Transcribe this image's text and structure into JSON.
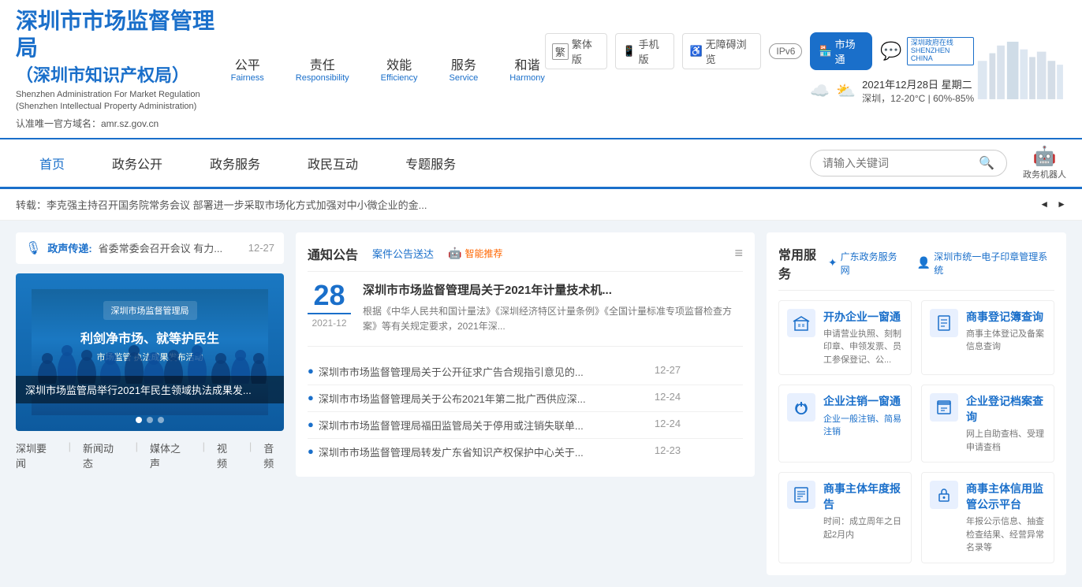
{
  "header": {
    "logo_title": "深圳市市场监督管理局",
    "logo_subtitle_line1": "（深圳市知识产权局）",
    "logo_en_line1": "Shenzhen Administration For Market Regulation",
    "logo_en_line2": "(Shenzhen Intellectual Property Administration)",
    "domain_label": "认准唯一官方域名：amr.sz.gov.cn",
    "tools": {
      "traditional": "繁体版",
      "mobile": "手机版",
      "accessible": "无障碍浏览",
      "ipv6": "IPv6",
      "market": "市场通"
    },
    "values": [
      {
        "cn": "公平",
        "en": "Fairness"
      },
      {
        "cn": "责任",
        "en": "Responsibility"
      },
      {
        "cn": "效能",
        "en": "Efficiency"
      },
      {
        "cn": "服务",
        "en": "Service"
      },
      {
        "cn": "和谐",
        "en": "Harmony"
      }
    ],
    "weather": {
      "date": "2021年12月28日 星期二",
      "location": "深圳，12-20°C",
      "humidity": "60%-85%"
    }
  },
  "nav": {
    "items": [
      "首页",
      "政务公开",
      "政务服务",
      "政民互动",
      "专题服务"
    ],
    "active": "首页",
    "search_placeholder": "请输入关键词",
    "robot_label": "政务机器人"
  },
  "ticker": {
    "text": "转载：李克强主持召开国务院常务会议 部署进一步采取市场化方式加强对中小微企业的金..."
  },
  "voice": {
    "label": "政声传递:",
    "text": "省委常委会召开会议 有力...",
    "date": "12-27"
  },
  "slideshow": {
    "caption": "深圳市场监管局举行2021年民生领域执法成果发...",
    "event_text": "利剑净市场、就等护民生",
    "subtitle": "市场监管 执法成果发布活动",
    "dots": 3,
    "active_dot": 0
  },
  "news_links": [
    "深圳要闻",
    "新闻动态",
    "媒体之声",
    "视频",
    "音频"
  ],
  "notice": {
    "title": "通知公告",
    "tabs": [
      "案件公告送达",
      "智能推荐"
    ],
    "featured": {
      "day": "28",
      "year_month": "2021-12",
      "title": "深圳市市场监督管理局关于2021年计量技术机...",
      "desc": "根据《中华人民共和国计量法》《深圳经济特区计量条例》《全国计量标准专项监督检查方案》等有关规定要求，2021年深..."
    },
    "list": [
      {
        "text": "深圳市市场监督管理局关于公开征求广告合规指引意见的...",
        "date": "12-27"
      },
      {
        "text": "深圳市市场监督管理局关于公布2021年第二批广西供应深...",
        "date": "12-24"
      },
      {
        "text": "深圳市市场监督管理局福田监管局关于停用或注销失联单...",
        "date": "12-24"
      },
      {
        "text": "深圳市市场监督管理局转发广东省知识产权保护中心关于...",
        "date": "12-23"
      }
    ]
  },
  "common_services": {
    "title": "常用服务",
    "links": [
      "广东政务服务网",
      "深圳市统一电子印章管理系统"
    ],
    "items": [
      {
        "name": "开办企业一窗通",
        "desc": "申请营业执照、刻制印章、申领发票、员工参保登记、公...",
        "icon": "🏢",
        "color": "#e8f0fe"
      },
      {
        "name": "商事登记簿查询",
        "desc": "商事主体登记及备案信息查询",
        "icon": "📋",
        "color": "#e8f0fe"
      },
      {
        "name": "企业注销一窗通",
        "subdesc": "企业一般注销、简易注销",
        "desc": "",
        "icon": "🔌",
        "color": "#e8f0fe"
      },
      {
        "name": "企业登记档案查询",
        "desc": "网上自助查档、受理申请查档",
        "icon": "📁",
        "color": "#e8f0fe"
      },
      {
        "name": "商事主体年度报告",
        "desc": "时间：成立周年之日起2月内",
        "icon": "📊",
        "color": "#e8f0fe"
      },
      {
        "name": "商事主体信用监管公示平台",
        "desc": "年报公示信息、抽查检查结果、经营异常名录等",
        "icon": "🔒",
        "color": "#e8f0fe"
      }
    ]
  }
}
